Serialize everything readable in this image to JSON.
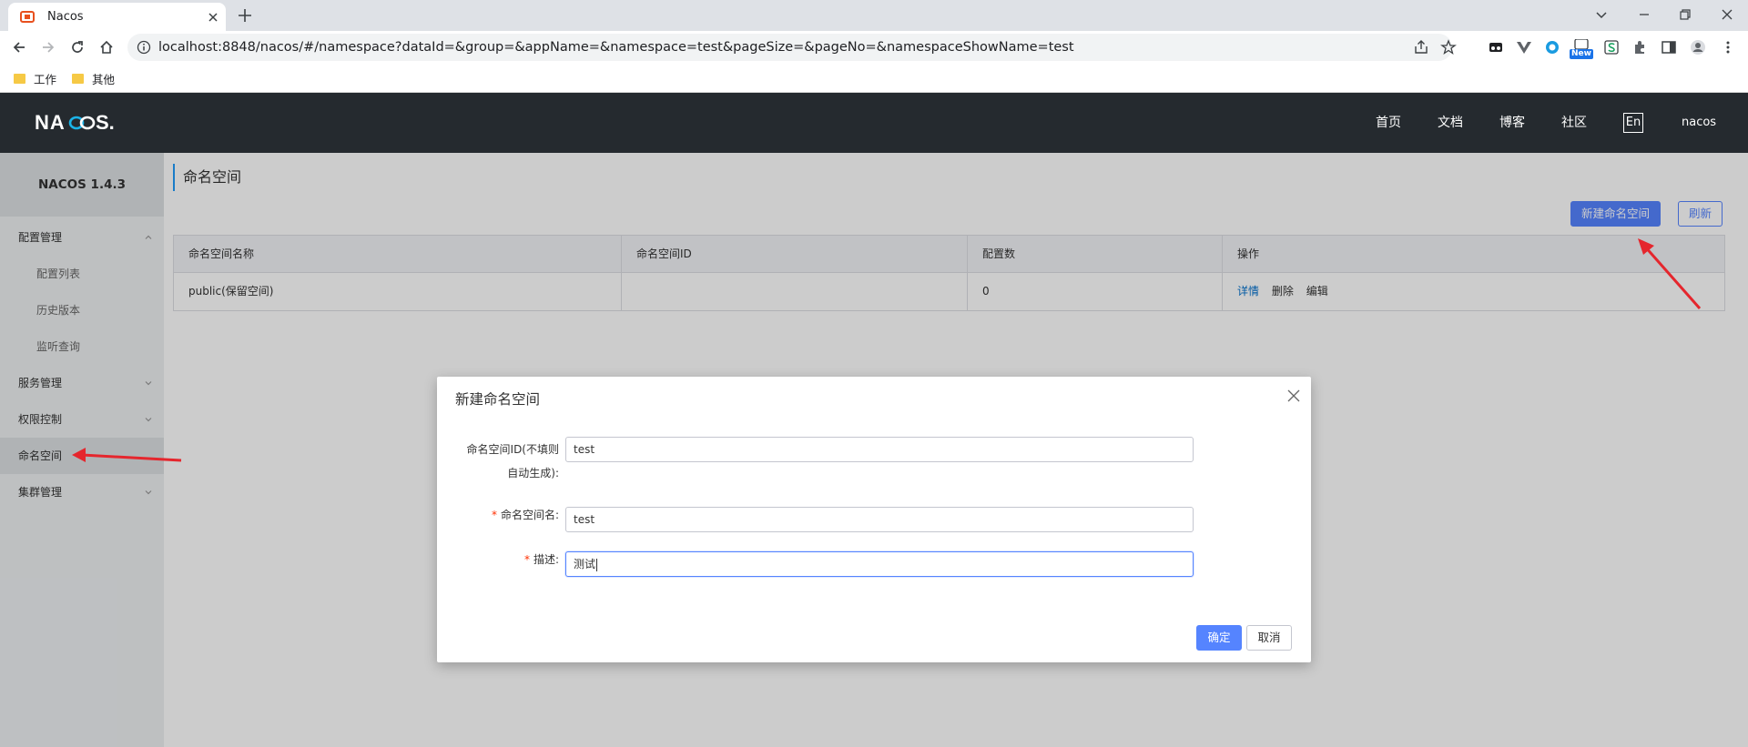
{
  "browser": {
    "tab_title": "Nacos",
    "url": "localhost:8848/nacos/#/namespace?dataId=&group=&appName=&namespace=test&pageSize=&pageNo=&namespaceShowName=test",
    "bookmarks": [
      "工作",
      "其他"
    ],
    "extension_badge": "New"
  },
  "header": {
    "logo": "NACOS.",
    "nav": [
      "首页",
      "文档",
      "博客",
      "社区"
    ],
    "lang": "En",
    "user": "nacos"
  },
  "sidebar": {
    "version": "NACOS 1.4.3",
    "menu": [
      {
        "label": "配置管理",
        "type": "group",
        "expanded": true
      },
      {
        "label": "配置列表",
        "type": "sub"
      },
      {
        "label": "历史版本",
        "type": "sub"
      },
      {
        "label": "监听查询",
        "type": "sub"
      },
      {
        "label": "服务管理",
        "type": "group",
        "expanded": false
      },
      {
        "label": "权限控制",
        "type": "group",
        "expanded": false
      },
      {
        "label": "命名空间",
        "type": "item",
        "active": true
      },
      {
        "label": "集群管理",
        "type": "group",
        "expanded": false
      }
    ]
  },
  "page": {
    "title": "命名空间",
    "new_button": "新建命名空间",
    "refresh_button": "刷新",
    "table": {
      "columns": [
        "命名空间名称",
        "命名空间ID",
        "配置数",
        "操作"
      ],
      "rows": [
        {
          "name": "public(保留空间)",
          "id": "",
          "count": "0",
          "actions": [
            "详情",
            "删除",
            "编辑"
          ]
        }
      ]
    }
  },
  "dialog": {
    "title": "新建命名空间",
    "id_label_line1": "命名空间ID(不填则",
    "id_label_line2": "自动生成):",
    "id_value": "test",
    "name_label": "命名空间名:",
    "name_value": "test",
    "desc_label": "描述:",
    "desc_value": "测试",
    "required_mark": "*",
    "ok": "确定",
    "cancel": "取消"
  },
  "colors": {
    "primary": "#5584ff",
    "nav_bg": "#252a2f",
    "annotation_arrow": "#e5262d"
  }
}
